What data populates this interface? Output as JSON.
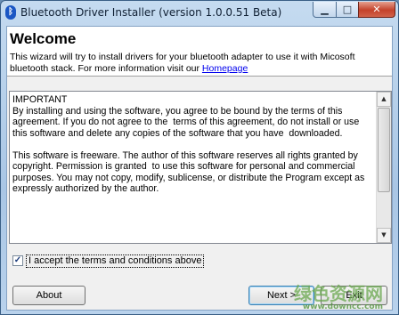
{
  "window": {
    "title": "Bluetooth Driver Installer (version 1.0.0.51 Beta)",
    "icon": "bluetooth-icon",
    "min_glyph": "▁",
    "max_glyph": "□",
    "close_glyph": "✕"
  },
  "header": {
    "heading": "Welcome",
    "intro_prefix": "This wizard will try to install drivers for your bluetooth adapter to use it with Micosoft bluetooth stack.   For more information visit our ",
    "homepage_link": "Homepage"
  },
  "agreement": {
    "text": "IMPORTANT\nBy installing and using the software, you agree to be bound by the terms of this agreement. If you do not agree to the  terms of this agreement, do not install or use this software and delete any copies of the software that you have  downloaded.\n\nThis software is freeware. The author of this software reserves all rights granted by copyright. Permission is granted  to use this software for personal and commercial purposes. You may not copy, modify, sublicense, or distribute the Program except as expressly authorized by the author.",
    "scroll_up": "▲",
    "scroll_down": "▼"
  },
  "accept": {
    "checked": true,
    "check_glyph": "✓",
    "label": "I accept the terms and conditions above"
  },
  "buttons": {
    "about": "About",
    "next": "Next >",
    "exit": "Exit"
  },
  "watermark": {
    "text": "绿色资源网",
    "url": "www.downcc.com"
  }
}
